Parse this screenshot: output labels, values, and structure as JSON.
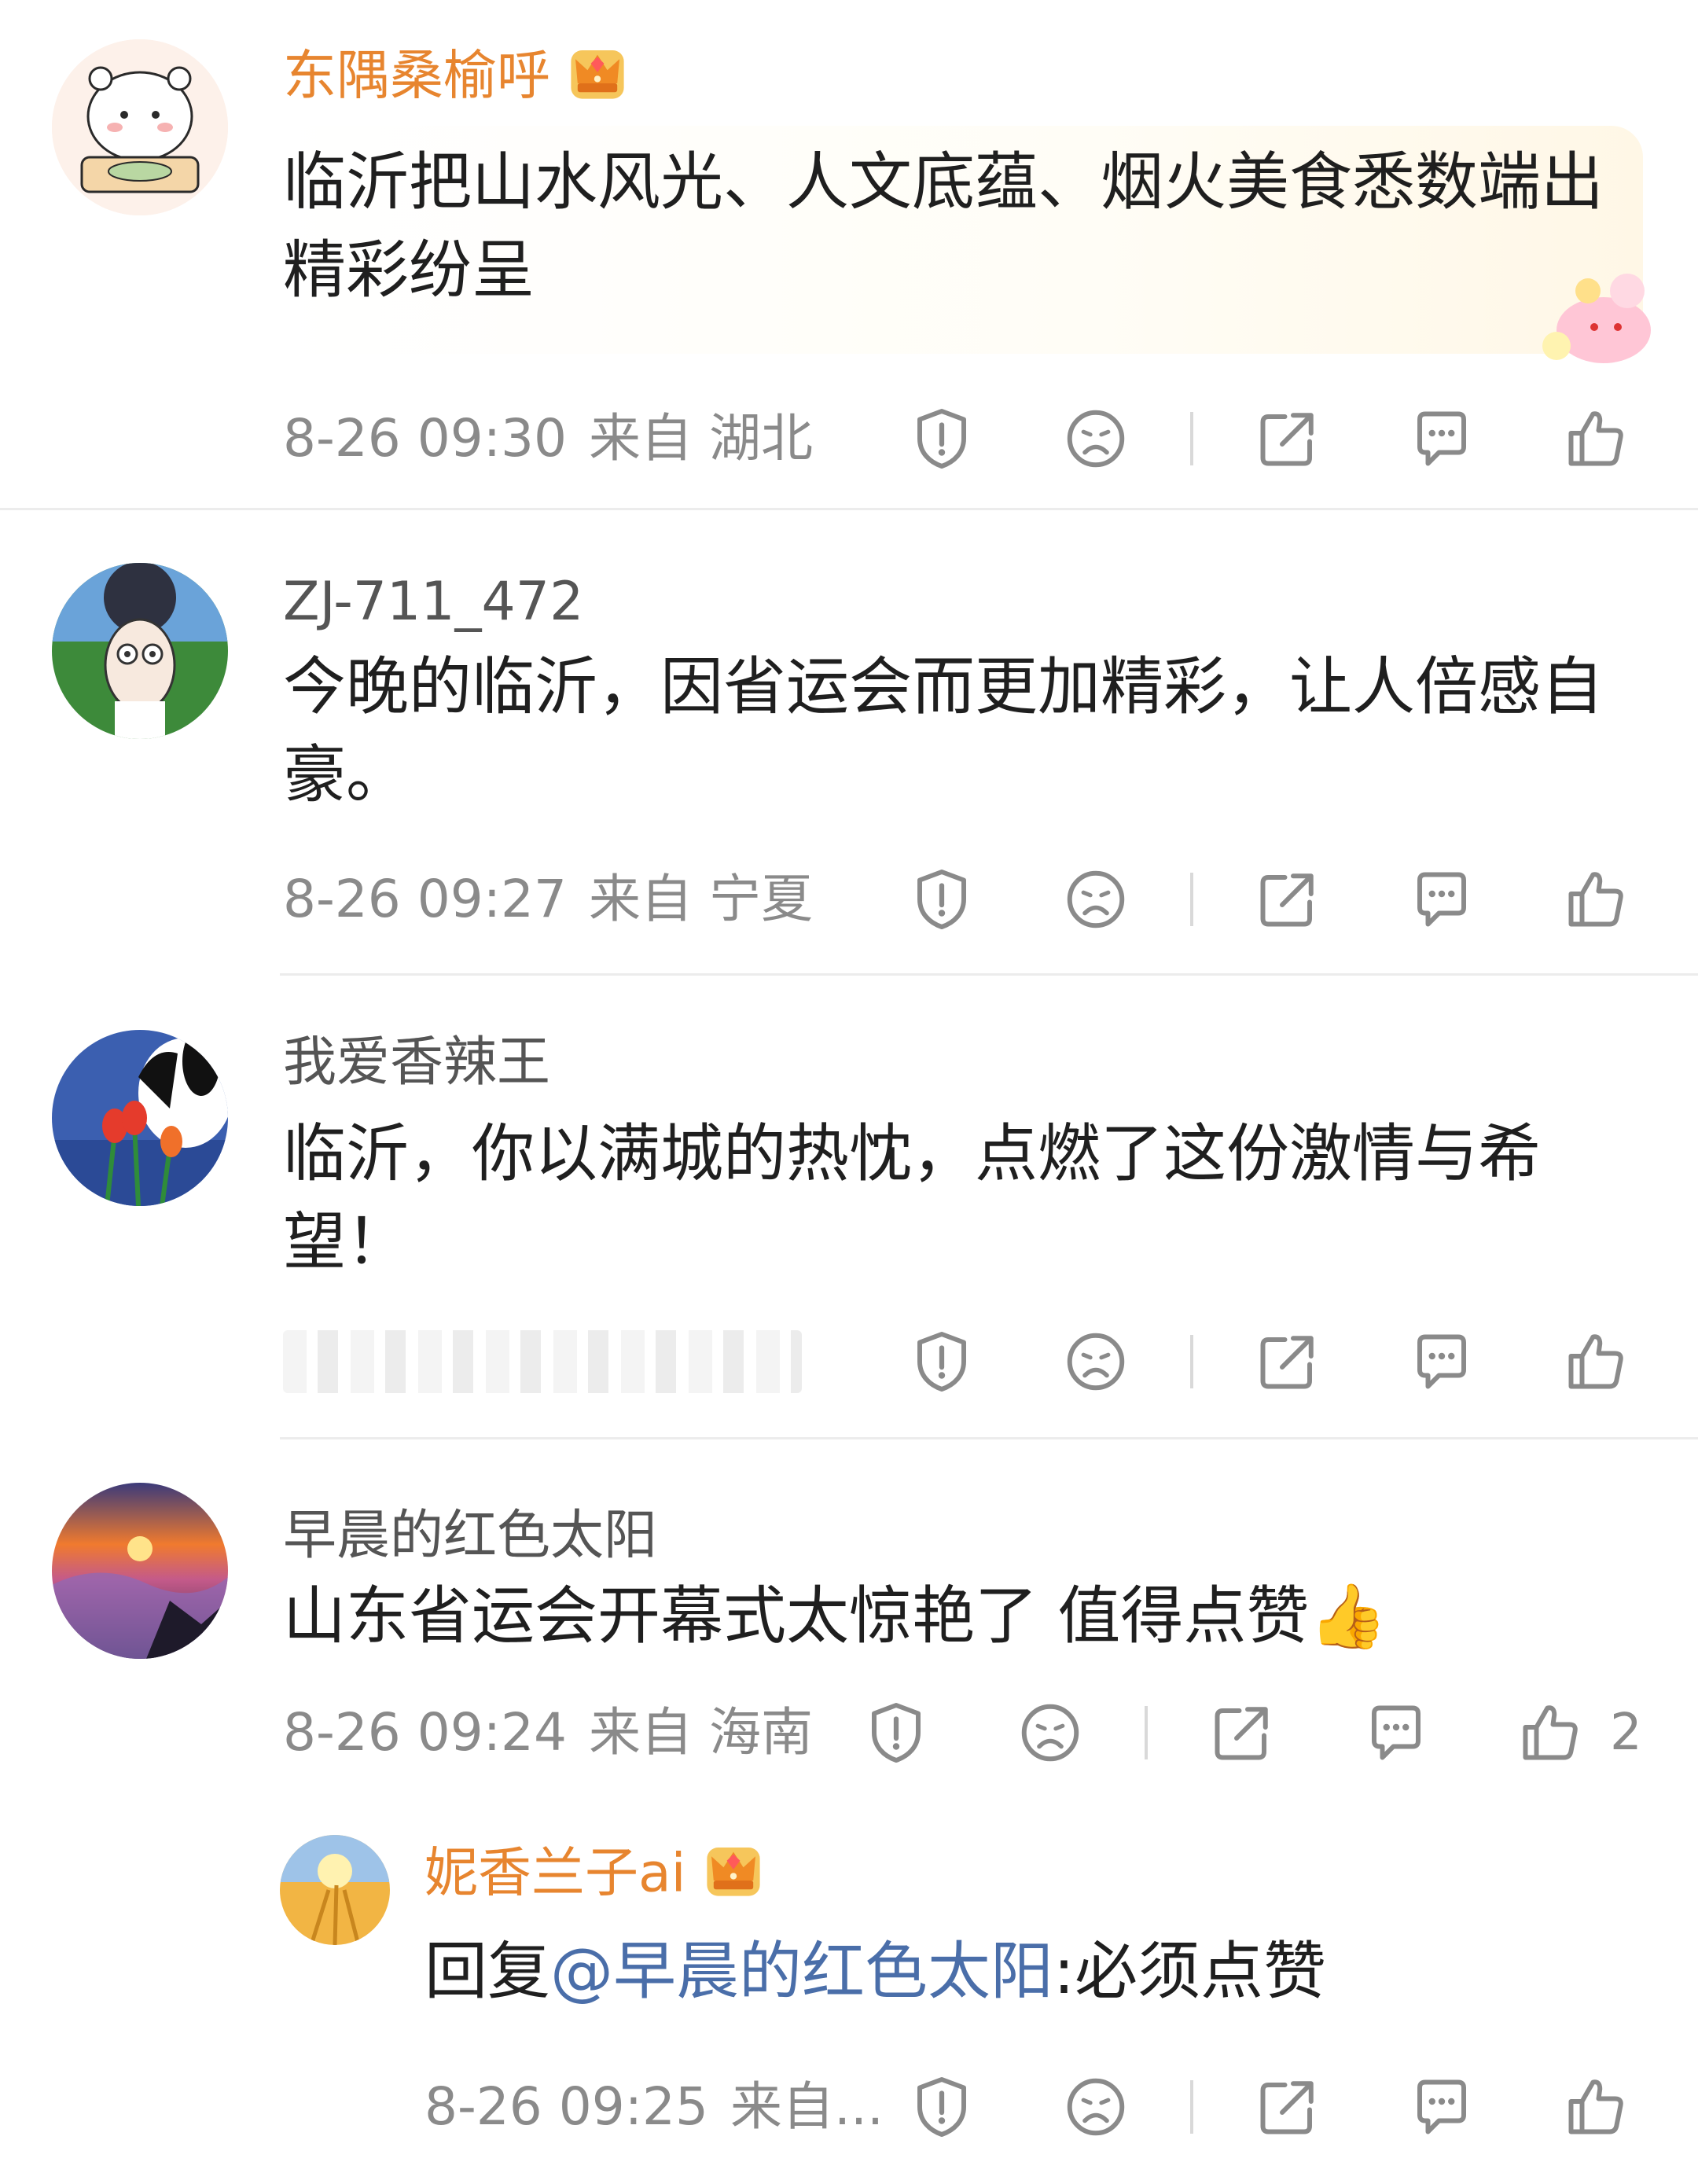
{
  "comments": [
    {
      "username": "东隅桑榆呼",
      "vip": true,
      "text": "临沂把山水风光、人文底蕴、烟火美食悉数端出精彩纷呈",
      "time": "8-26 09:30",
      "location": "来自 湖北",
      "likes": ""
    },
    {
      "username": "ZJ-711_472",
      "vip": false,
      "text": "今晚的临沂，因省运会而更加精彩，让人倍感自豪。",
      "time": "8-26 09:27",
      "location": "来自 宁夏",
      "likes": ""
    },
    {
      "username": "我爱香辣王",
      "vip": false,
      "text": "临沂，你以满城的热忱，点燃了这份激情与希望！",
      "time": "",
      "location": "",
      "likes": ""
    },
    {
      "username": "早晨的红色太阳",
      "vip": false,
      "text": "山东省运会开幕式太惊艳了 值得点赞👍",
      "time": "8-26 09:24",
      "location": "来自 海南",
      "likes": "2"
    }
  ],
  "reply": {
    "username": "妮香兰子ai",
    "vip": true,
    "prefix": "回复",
    "mention": "@早晨的红色太阳",
    "text": ":必须点赞",
    "time": "8-26 09:25",
    "location": "来自..."
  },
  "icons": {
    "report": "shield-exclamation-icon",
    "dislike": "sad-face-icon",
    "share": "share-icon",
    "reply": "comment-icon",
    "like": "thumbs-up-icon"
  },
  "colors": {
    "vip_name": "#e7852f",
    "mention": "#4a6ea9",
    "meta": "#8a8a8a"
  }
}
